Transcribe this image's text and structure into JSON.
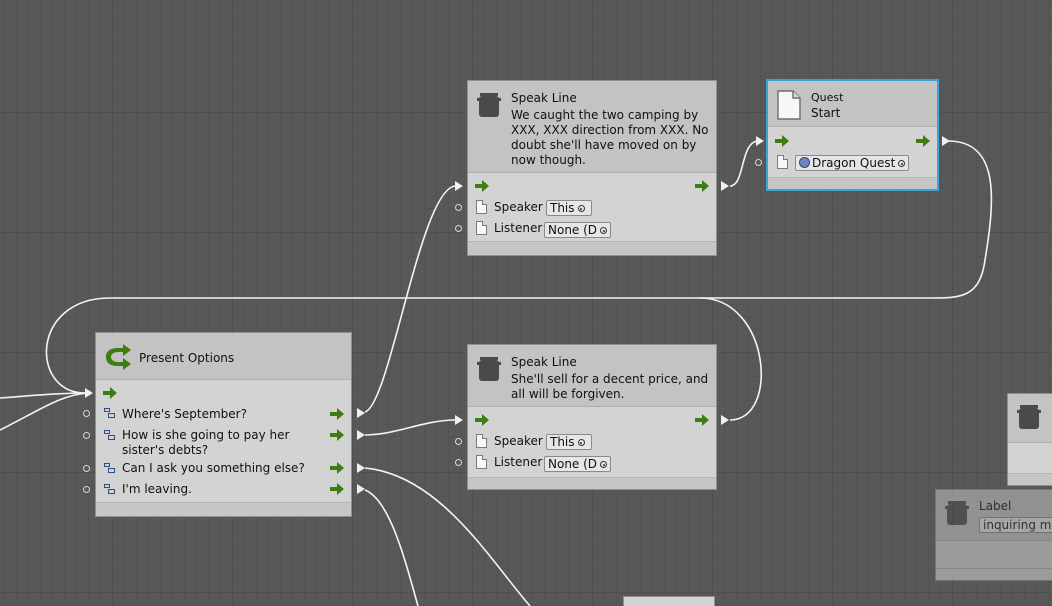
{
  "node_speak_1": {
    "title": "Speak Line",
    "text": "We caught the two camping by XXX, XXX direction from XXX. No doubt she'll have moved on by now though.",
    "speaker_label": "Speaker",
    "speaker_value": "This",
    "listener_label": "Listener",
    "listener_value": "None (D"
  },
  "node_quest": {
    "category": "Quest",
    "title": "Start",
    "quest_value": "Dragon Quest"
  },
  "node_options": {
    "title": "Present Options",
    "options": [
      {
        "label": "Where's September?"
      },
      {
        "label": "How is she going to pay her sister's debts?"
      },
      {
        "label": "Can I ask you something else?"
      },
      {
        "label": "I'm leaving."
      }
    ]
  },
  "node_speak_2": {
    "title": "Speak Line",
    "text": "She'll sell for a decent price, and all will be forgiven.",
    "speaker_label": "Speaker",
    "speaker_value": "This",
    "listener_label": "Listener",
    "listener_value": "None (D"
  },
  "node_label": {
    "title": "Label",
    "value": "inquiring mor"
  },
  "colors": {
    "canvas": "#585858",
    "node_body": "#d3d3d3",
    "node_header": "#c3c3c3",
    "flow_arrow": "#3f7d12",
    "wire": "#f0f0f0",
    "selection": "#3aa3d9"
  }
}
